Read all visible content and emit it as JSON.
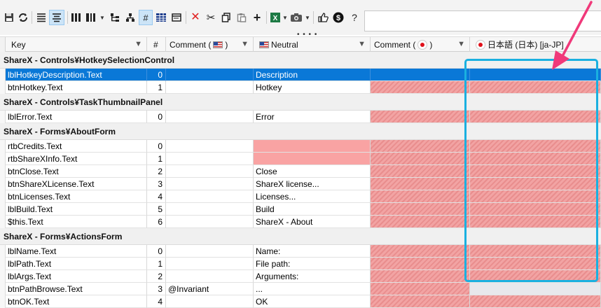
{
  "toolbar": {
    "icons": [
      "save-icon",
      "refresh-icon",
      "align-left-icon",
      "align-center-icon",
      "columns-icon",
      "column-chooser-icon",
      "tree-icon",
      "hierarchy-icon",
      "number-sign-icon",
      "grid-icon",
      "window-icon",
      "delete-icon",
      "cut-icon",
      "copy-icon",
      "paste-icon",
      "add-icon",
      "excel-icon",
      "camera-icon",
      "thumbs-up-icon",
      "dollar-icon",
      "help-icon"
    ],
    "number_sign": "#",
    "help": "?",
    "grip": "• • • •"
  },
  "search": {
    "value": "",
    "placeholder": ""
  },
  "columns": {
    "key": "Key",
    "num": "#",
    "comment": "Comment (",
    "comment_end": ")",
    "neutral": "Neutral",
    "jcomment": "Comment (",
    "jcomment_end": ")",
    "japan": "日本語 (日本) [ja-JP]"
  },
  "groups": [
    {
      "title": "ShareX - Controls¥HotkeySelectionControl",
      "rows": [
        {
          "key": "lblHotkeyDescription.Text",
          "num": "0",
          "comment": "",
          "neutral": "Description",
          "selected": true
        },
        {
          "key": "btnHotkey.Text",
          "num": "1",
          "comment": "",
          "neutral": "Hotkey"
        }
      ]
    },
    {
      "title": "ShareX - Controls¥TaskThumbnailPanel",
      "rows": [
        {
          "key": "lblError.Text",
          "num": "0",
          "comment": "",
          "neutral": "Error"
        }
      ]
    },
    {
      "title": "ShareX - Forms¥AboutForm",
      "rows": [
        {
          "key": "rtbCredits.Text",
          "num": "0",
          "comment": "",
          "neutral": "",
          "neutral_pink": true
        },
        {
          "key": "rtbShareXInfo.Text",
          "num": "1",
          "comment": "",
          "neutral": "",
          "neutral_pink": true
        },
        {
          "key": "btnClose.Text",
          "num": "2",
          "comment": "",
          "neutral": "Close"
        },
        {
          "key": "btnShareXLicense.Text",
          "num": "3",
          "comment": "",
          "neutral": "ShareX license..."
        },
        {
          "key": "btnLicenses.Text",
          "num": "4",
          "comment": "",
          "neutral": "Licenses..."
        },
        {
          "key": "lblBuild.Text",
          "num": "5",
          "comment": "",
          "neutral": "Build"
        },
        {
          "key": "$this.Text",
          "num": "6",
          "comment": "",
          "neutral": "ShareX - About"
        }
      ]
    },
    {
      "title": "ShareX - Forms¥ActionsForm",
      "rows": [
        {
          "key": "lblName.Text",
          "num": "0",
          "comment": "",
          "neutral": "Name:"
        },
        {
          "key": "lblPath.Text",
          "num": "1",
          "comment": "",
          "neutral": "File path:"
        },
        {
          "key": "lblArgs.Text",
          "num": "2",
          "comment": "",
          "neutral": "Arguments:"
        },
        {
          "key": "btnPathBrowse.Text",
          "num": "3",
          "comment": "@Invariant",
          "neutral": "...",
          "japan_grey": true
        },
        {
          "key": "btnOK.Text",
          "num": "4",
          "comment": "",
          "neutral": "OK"
        }
      ]
    }
  ],
  "colors": {
    "selection": "#0a78d7",
    "missing_hatch": "#f2a3a3",
    "missing_pink": "#f9a3a3",
    "highlight_box": "#1ab0e0",
    "arrow": "#f0397a"
  }
}
